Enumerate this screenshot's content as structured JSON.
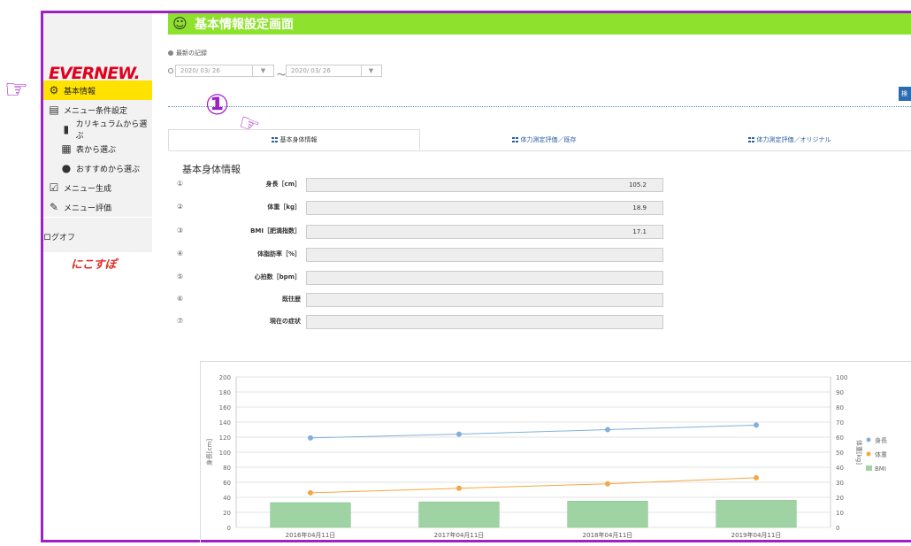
{
  "header": {
    "title": "基本情報設定画面"
  },
  "brand": {
    "logo": "EVERNEW.",
    "partner_logo": "にこすぽ"
  },
  "sidebar": {
    "items": [
      {
        "label": "基本情報",
        "icon": "gear-icon",
        "active": true
      },
      {
        "label": "メニュー条件設定",
        "icon": "clipboard-icon"
      },
      {
        "label": "カリキュラムから選ぶ",
        "icon": "document-icon"
      },
      {
        "label": "表から選ぶ",
        "icon": "table-icon"
      },
      {
        "label": "おすすめから選ぶ",
        "icon": "lightbulb-icon"
      },
      {
        "label": "メニュー生成",
        "icon": "checkbox-icon"
      },
      {
        "label": "メニュー評価",
        "icon": "pencil-icon"
      }
    ],
    "logout": "ログオフ"
  },
  "filter": {
    "latest_label": "最新の記録",
    "date_from": "2020/ 03/ 26",
    "date_to": "2020/ 03/ 26",
    "tilde": "～",
    "search_button": "検"
  },
  "annotation": {
    "number": "①"
  },
  "tabs": [
    "基本身体情報",
    "体力測定評価／既存",
    "体力測定評価／オリジナル"
  ],
  "basic_info": {
    "title": "基本身体情報",
    "rows": [
      {
        "num": "①",
        "label": "身長［cm］",
        "value": "105.2"
      },
      {
        "num": "②",
        "label": "体重［kg］",
        "value": "18.9"
      },
      {
        "num": "③",
        "label": "BMI［肥満指数］",
        "value": "17.1"
      },
      {
        "num": "④",
        "label": "体脂肪率［%］",
        "value": ""
      },
      {
        "num": "⑤",
        "label": "心拍数［bpm］",
        "value": ""
      },
      {
        "num": "⑥",
        "label": "既往歴",
        "value": ""
      },
      {
        "num": "⑦",
        "label": "現在の症状",
        "value": ""
      }
    ]
  },
  "chart_data": {
    "type": "bar",
    "categories": [
      "2016年04月11日",
      "2017年04月11日",
      "2018年04月11日",
      "2019年04月11日"
    ],
    "series": [
      {
        "name": "身長",
        "kind": "line",
        "axis": "left",
        "color": "#7fb1dc",
        "values": [
          119,
          124,
          130,
          136
        ]
      },
      {
        "name": "体重",
        "kind": "line",
        "axis": "right",
        "color": "#f5a742",
        "values": [
          23,
          26,
          29,
          33
        ]
      },
      {
        "name": "BMI",
        "kind": "bar",
        "axis": "right",
        "color": "#9fd3a4",
        "values": [
          16.5,
          17,
          17.5,
          18
        ]
      }
    ],
    "ylabel": "身長[cm]",
    "y2label": "体重[kg]",
    "ylim": [
      0,
      200
    ],
    "y2lim": [
      0,
      100
    ],
    "yticks": [
      "0",
      "20",
      "40",
      "60",
      "80",
      "100",
      "120",
      "140",
      "160",
      "180",
      "200"
    ],
    "y2ticks": [
      "0",
      "10",
      "20",
      "30",
      "40",
      "50",
      "60",
      "70",
      "80",
      "90",
      "100"
    ],
    "grid": true,
    "legend": "right"
  }
}
